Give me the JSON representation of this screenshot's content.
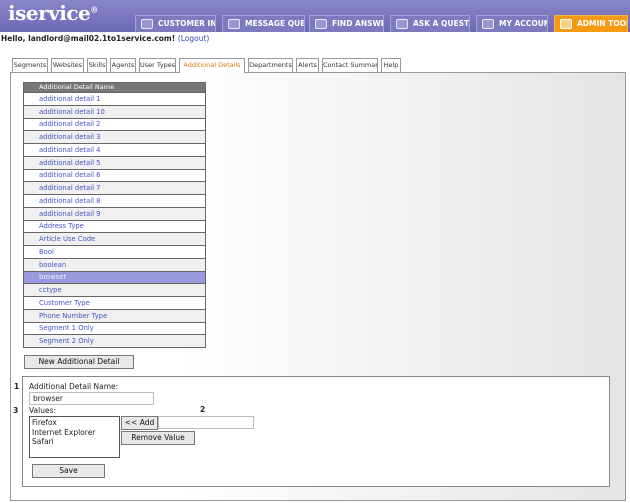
{
  "logo": {
    "text": "service",
    "mark": "®"
  },
  "nav": [
    {
      "label": "CUSTOMER INFO",
      "icon": "customer-icon"
    },
    {
      "label": "MESSAGE QUEUE",
      "icon": "message-icon"
    },
    {
      "label": "FIND ANSWERS",
      "icon": "book-icon"
    },
    {
      "label": "ASK A QUESTION",
      "icon": "question-icon"
    },
    {
      "label": "MY ACCOUNT",
      "icon": "account-icon"
    },
    {
      "label": "ADMIN TOOLS",
      "icon": "tools-icon"
    }
  ],
  "greeting": {
    "text": "Hello, landlord@mail02.1to1service.com!",
    "logout": "(Logout)"
  },
  "subtabs": [
    "Segments",
    "Websites",
    "Skills",
    "Agents",
    "User Types",
    "Additional Details",
    "Departments",
    "Alerts",
    "Contact Summary",
    "Help"
  ],
  "table": {
    "header": "Additional Detail Name",
    "rows": [
      "additional detail 1",
      "additional detail 10",
      "additional detail 2",
      "additional detail 3",
      "additional detail 4",
      "additional detail 5",
      "additional detail 6",
      "additional detail 7",
      "additional detail 8",
      "additional detail 9",
      "Address Type",
      "Article Use Code",
      "Bool",
      "boolean",
      "browser",
      "cctype",
      "Customer Type",
      "Phone Number Type",
      "Segment 1 Only",
      "Segment 2 Only"
    ],
    "selected": "browser"
  },
  "new_button": "New Additional Detail",
  "form": {
    "num1": "1",
    "num2": "2",
    "num3": "3",
    "name_label": "Additional Detail Name:",
    "name_value": "browser",
    "values_label": "Values:",
    "values": [
      "Firefox",
      "Internet Explorer",
      "Safari"
    ],
    "add_button": "<< Add",
    "remove_button": "Remove Value",
    "save_button": "Save",
    "new_value": ""
  }
}
